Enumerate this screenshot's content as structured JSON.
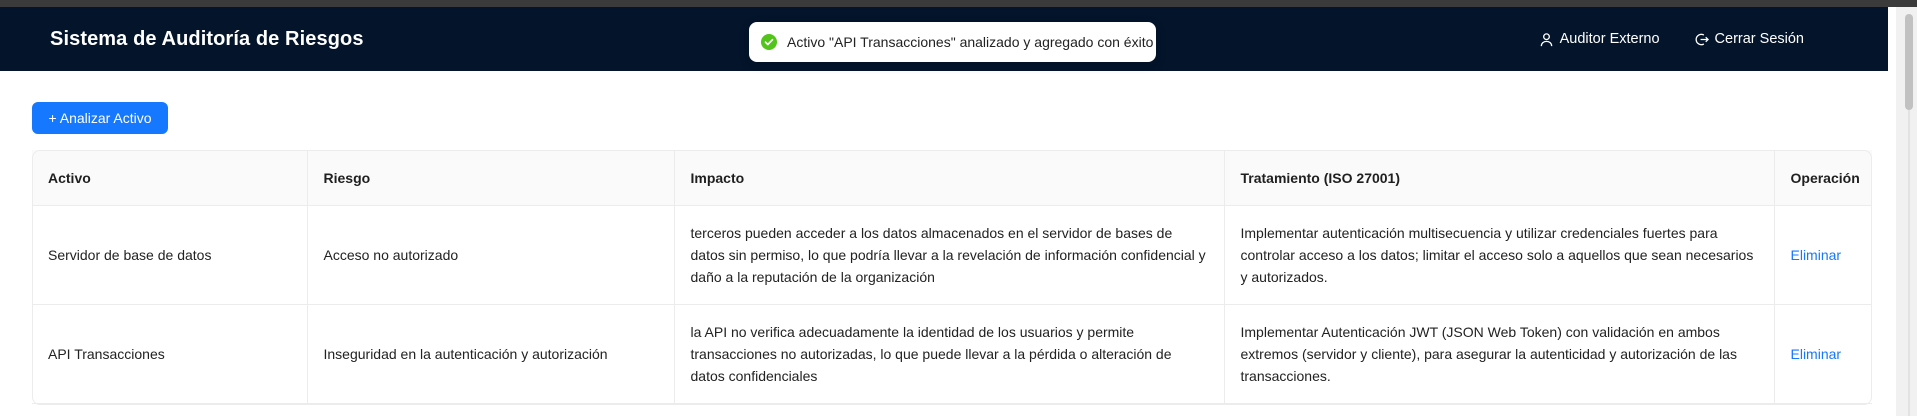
{
  "header": {
    "title": "Sistema de Auditoría de Riesgos",
    "user_label": "Auditor Externo",
    "logout_label": "Cerrar Sesión"
  },
  "toast": {
    "message": "Activo \"API Transacciones\" analizado y agregado con éxito",
    "status_color": "#52c41a"
  },
  "actions": {
    "analyze_label": "+ Analizar Activo"
  },
  "table": {
    "columns": [
      "Activo",
      "Riesgo",
      "Impacto",
      "Tratamiento (ISO 27001)",
      "Operación"
    ],
    "rows": [
      {
        "activo": "Servidor de base de datos",
        "riesgo": "Acceso no autorizado",
        "impacto": "terceros pueden acceder a los datos almacenados en el servidor de bases de datos sin permiso, lo que podría llevar a la revelación de información confidencial y daño a la reputación de la organización",
        "tratamiento": "Implementar autenticación multisecuencia y utilizar credenciales fuertes para controlar acceso a los datos; limitar el acceso solo a aquellos que sean necesarios y autorizados.",
        "operacion": "Eliminar"
      },
      {
        "activo": "API Transacciones",
        "riesgo": "Inseguridad en la autenticación y autorización",
        "impacto": "la API no verifica adecuadamente la identidad de los usuarios y permite transacciones no autorizadas, lo que puede llevar a la pérdida o alteración de datos confidenciales",
        "tratamiento": "Implementar Autenticación JWT (JSON Web Token) con validación en ambos extremos (servidor y cliente), para asegurar la autenticidad y autorización de las transacciones.",
        "operacion": "Eliminar"
      }
    ]
  },
  "colors": {
    "header_bg": "#03142b",
    "primary": "#1677ff"
  }
}
